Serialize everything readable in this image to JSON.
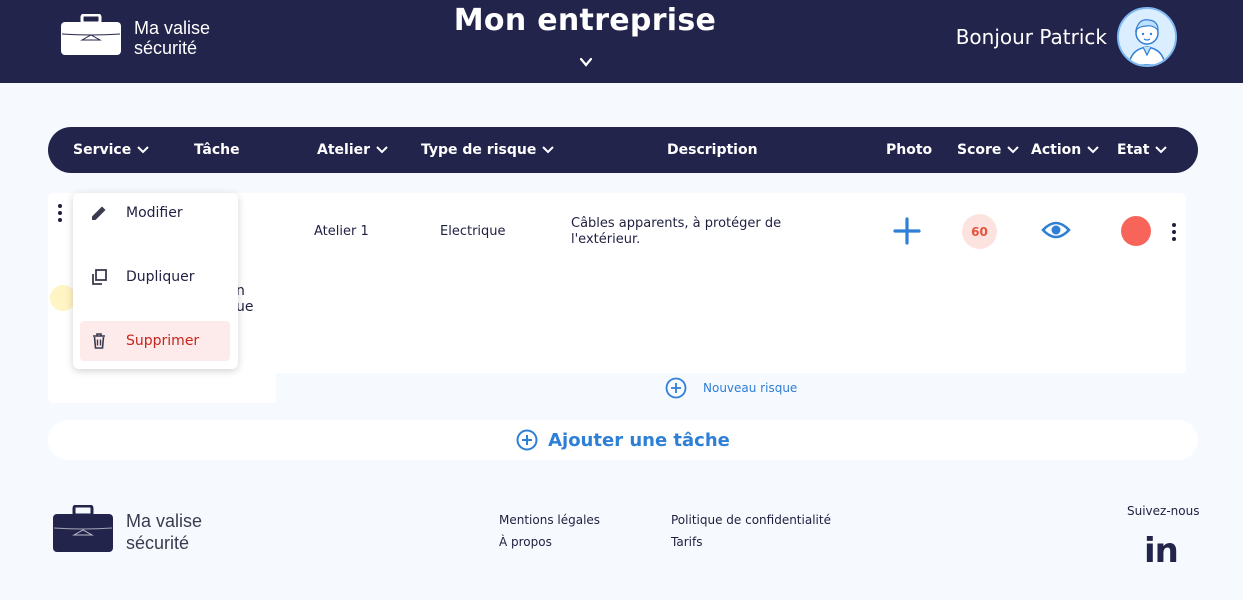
{
  "header": {
    "brand_line1": "Ma valise",
    "brand_line2": "sécurité",
    "company_title": "Mon entreprise",
    "greeting": "Bonjour Patrick"
  },
  "table": {
    "columns": [
      "Service",
      "Tâche",
      "Atelier",
      "Type de risque",
      "Description",
      "Photo",
      "Score",
      "Action",
      "Etat"
    ],
    "row": {
      "atelier": "Atelier 1",
      "type_risque": "Electrique",
      "description_line1": "Câbles apparents, à protéger de",
      "description_line2": "l'extérieur.",
      "score": "60",
      "etat_color": "#f7655a",
      "partial_task_line1": "n",
      "partial_task_line2": "ue"
    },
    "new_risk_label": "Nouveau risque"
  },
  "context_menu": {
    "items": [
      {
        "label": "Modifier",
        "icon": "pencil-icon"
      },
      {
        "label": "Dupliquer",
        "icon": "duplicate-icon"
      },
      {
        "label": "Supprimer",
        "icon": "trash-icon"
      }
    ]
  },
  "add_task_label": "Ajouter une tâche",
  "footer": {
    "brand_line1": "Ma valise",
    "brand_line2": "sécurité",
    "links": [
      "Mentions légales",
      "À propos",
      "Politique de confidentialité",
      "Tarifs"
    ],
    "follow": "Suivez-nous",
    "social": "in"
  },
  "colors": {
    "navy": "#23244b",
    "accent_blue": "#2e7fd6",
    "danger": "#c8251c"
  }
}
